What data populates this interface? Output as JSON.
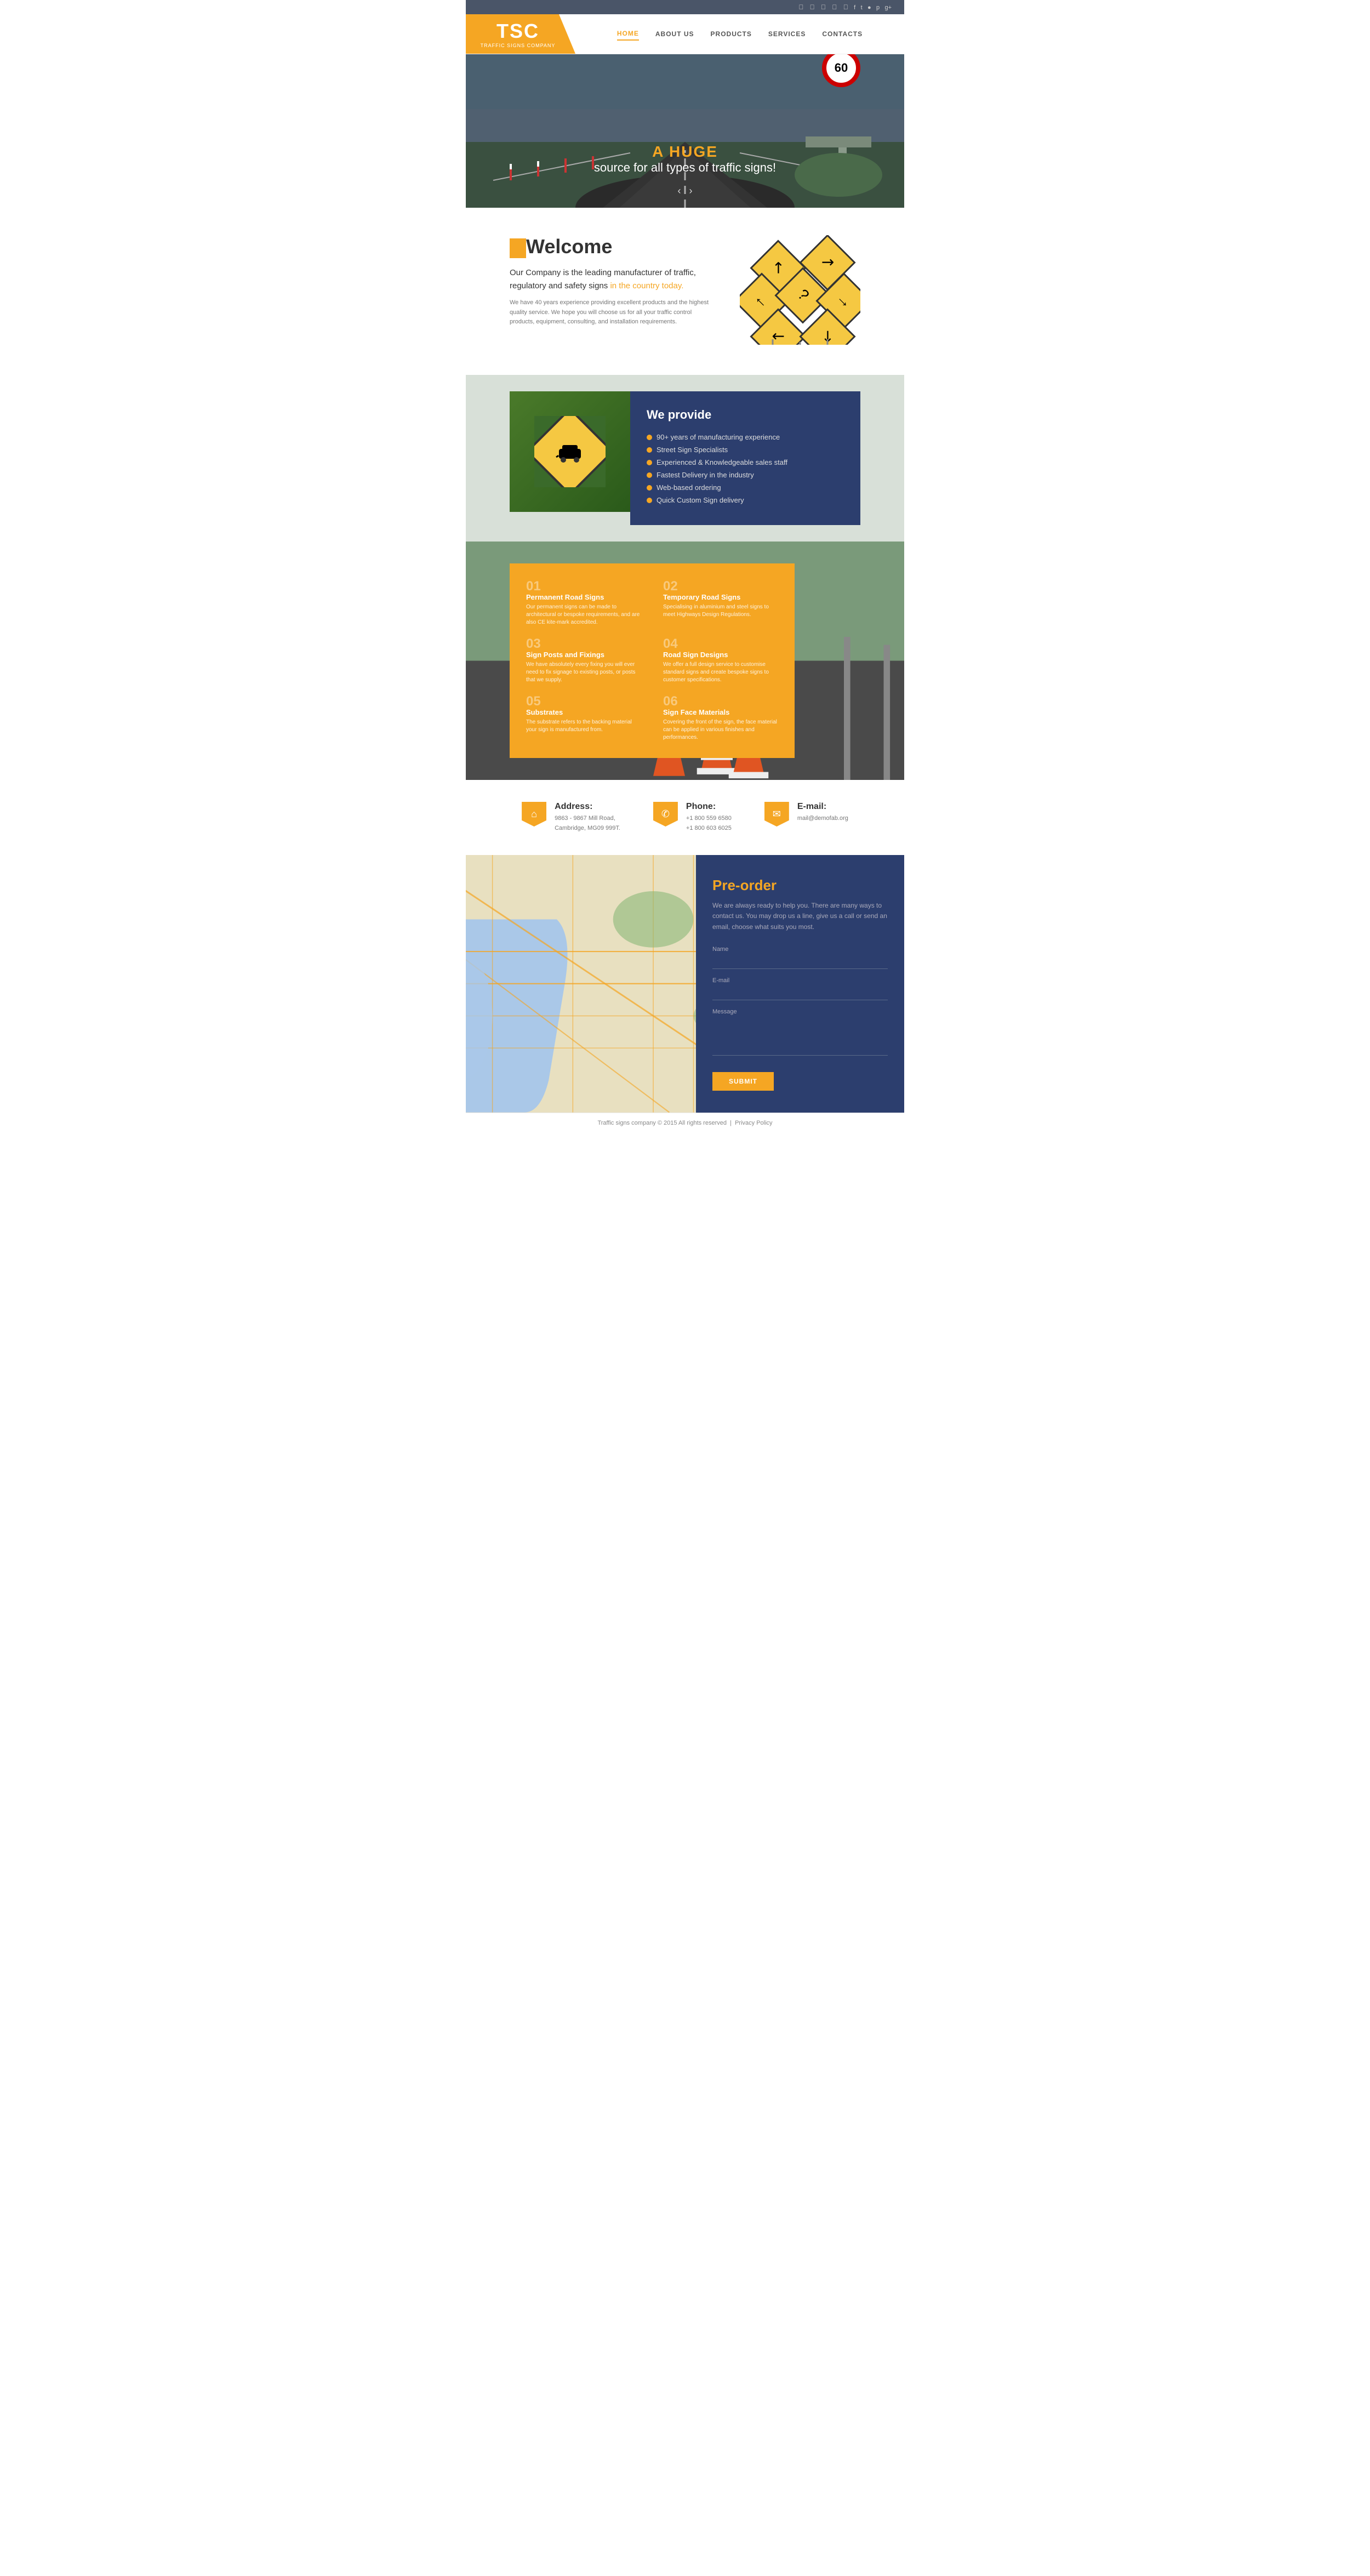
{
  "social": {
    "icons": [
      "f",
      "t",
      "ig",
      "p",
      "g+"
    ]
  },
  "header": {
    "logo_main": "TSC",
    "logo_sub": "TRAFFIC SIGNS COMPANY",
    "nav_items": [
      {
        "label": "HOME",
        "active": true
      },
      {
        "label": "ABOUT US",
        "active": false
      },
      {
        "label": "PRODUCTS",
        "active": false
      },
      {
        "label": "SERVICES",
        "active": false
      },
      {
        "label": "CONTACTS",
        "active": false
      }
    ]
  },
  "hero": {
    "title_orange": "A HUGE",
    "title_white": "source for all types of traffic signs!",
    "speed_limit": "60"
  },
  "welcome": {
    "title": "Welcome",
    "body_main": "Our Company is the leading manufacturer of traffic, regulatory and safety signs ",
    "body_highlight": "in the country today.",
    "body_small": "We have 40 years experience providing excellent products and the highest quality service. We hope you will choose us for all your traffic control products, equipment, consulting, and installation requirements."
  },
  "we_provide": {
    "title": "We provide",
    "items": [
      "90+ years of manufacturing experience",
      "Street Sign Specialists",
      "Experienced & Knowledgeable sales staff",
      "Fastest Delivery in the industry",
      "Web-based ordering",
      "Quick Custom Sign delivery"
    ]
  },
  "services": {
    "items": [
      {
        "num": "01",
        "title": "Permanent Road Signs",
        "desc": "Our permanent signs can be made to architectural or bespoke requirements, and are also CE kite-mark accredited."
      },
      {
        "num": "02",
        "title": "Temporary Road Signs",
        "desc": "Specialising in aluminium and steel signs to meet Highways Design Regulations."
      },
      {
        "num": "03",
        "title": "Sign Posts and Fixings",
        "desc": "We have absolutely every fixing you will ever need to fix signage to existing posts, or posts that we supply."
      },
      {
        "num": "04",
        "title": "Road Sign Designs",
        "desc": "We offer a full design service to customise standard signs and create bespoke signs to customer specifications."
      },
      {
        "num": "05",
        "title": "Substrates",
        "desc": "The substrate refers to the backing material your sign is manufactured from."
      },
      {
        "num": "06",
        "title": "Sign Face Materials",
        "desc": "Covering the front of the sign, the face material can be applied in various finishes and performances."
      }
    ]
  },
  "contact_info": {
    "address_label": "Address:",
    "address_value": "9863 - 9867 Mill Road,\nCambridge, MG09 999T.",
    "phone_label": "Phone:",
    "phone_value": "+1 800 559 6580\n+1 800 603 6025",
    "email_label": "E-mail:",
    "email_value": "mail@demofab.org"
  },
  "preorder": {
    "title": "Pre-order",
    "desc": "We are always ready to help you. There are many ways to contact us. You may drop us a line, give us a call or send an email, choose what suits you most.",
    "name_label": "Name",
    "email_label": "E-mail",
    "message_label": "Message",
    "submit_label": "SUBMIT"
  },
  "footer": {
    "text": "Traffic signs company © 2015 All rights reserved",
    "privacy": "Privacy Policy"
  }
}
